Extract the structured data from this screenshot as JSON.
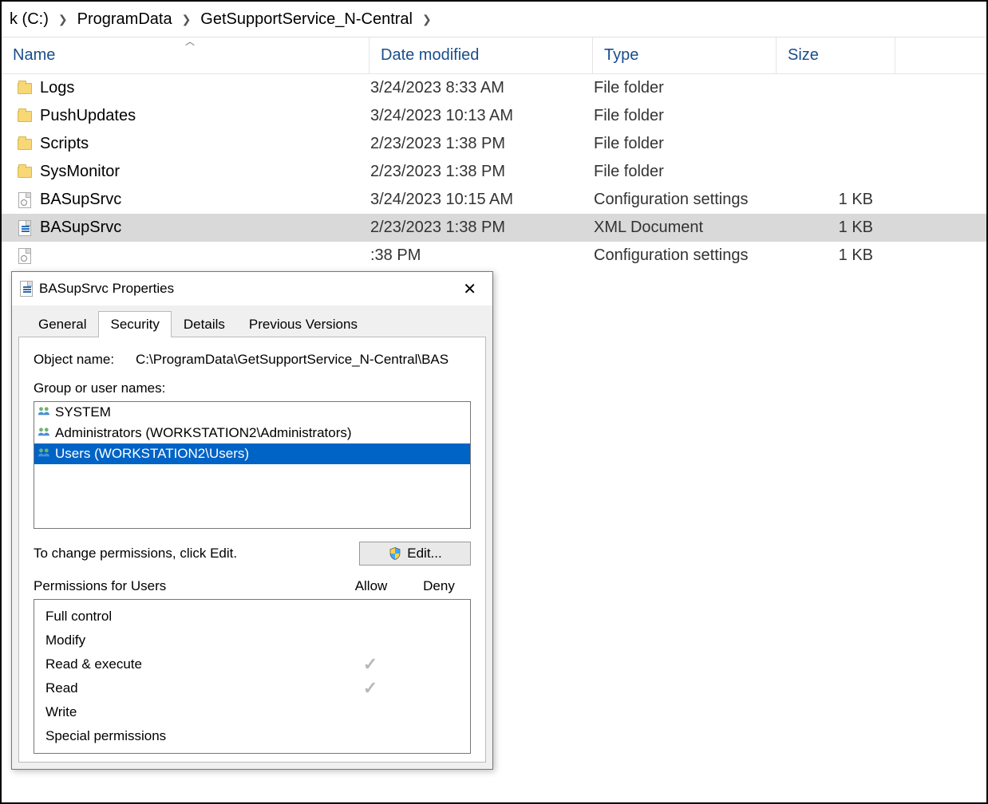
{
  "breadcrumb": {
    "items": [
      "k (C:)",
      "ProgramData",
      "GetSupportService_N-Central"
    ]
  },
  "columns": {
    "name": "Name",
    "date": "Date modified",
    "type": "Type",
    "size": "Size"
  },
  "files": [
    {
      "icon": "folder",
      "name": "Logs",
      "date": "3/24/2023 8:33 AM",
      "type": "File folder",
      "size": ""
    },
    {
      "icon": "folder",
      "name": "PushUpdates",
      "date": "3/24/2023 10:13 AM",
      "type": "File folder",
      "size": ""
    },
    {
      "icon": "folder",
      "name": "Scripts",
      "date": "2/23/2023 1:38 PM",
      "type": "File folder",
      "size": ""
    },
    {
      "icon": "folder",
      "name": "SysMonitor",
      "date": "2/23/2023 1:38 PM",
      "type": "File folder",
      "size": ""
    },
    {
      "icon": "cfg",
      "name": "BASupSrvc",
      "date": "3/24/2023 10:15 AM",
      "type": "Configuration settings",
      "size": "1 KB"
    },
    {
      "icon": "xml",
      "name": "BASupSrvc",
      "date": "2/23/2023 1:38 PM",
      "type": "XML Document",
      "size": "1 KB",
      "selected": true
    },
    {
      "icon": "cfg",
      "name": "",
      "date": ":38 PM",
      "type": "Configuration settings",
      "size": "1 KB",
      "obscured": true
    }
  ],
  "dialog": {
    "title": "BASupSrvc Properties",
    "tabs": [
      "General",
      "Security",
      "Details",
      "Previous Versions"
    ],
    "active_tab": 1,
    "object_label": "Object name:",
    "object_value": "C:\\ProgramData\\GetSupportService_N-Central\\BAS",
    "group_label": "Group or user names:",
    "groups": [
      {
        "name": "SYSTEM"
      },
      {
        "name": "Administrators (WORKSTATION2\\Administrators)"
      },
      {
        "name": "Users (WORKSTATION2\\Users)",
        "selected": true
      }
    ],
    "change_hint": "To change permissions, click Edit.",
    "edit_label": "Edit...",
    "perm_header": {
      "title": "Permissions for Users",
      "allow": "Allow",
      "deny": "Deny"
    },
    "permissions": [
      {
        "name": "Full control",
        "allow": false,
        "deny": false
      },
      {
        "name": "Modify",
        "allow": false,
        "deny": false
      },
      {
        "name": "Read & execute",
        "allow": true,
        "deny": false
      },
      {
        "name": "Read",
        "allow": true,
        "deny": false
      },
      {
        "name": "Write",
        "allow": false,
        "deny": false
      },
      {
        "name": "Special permissions",
        "allow": false,
        "deny": false
      }
    ]
  }
}
